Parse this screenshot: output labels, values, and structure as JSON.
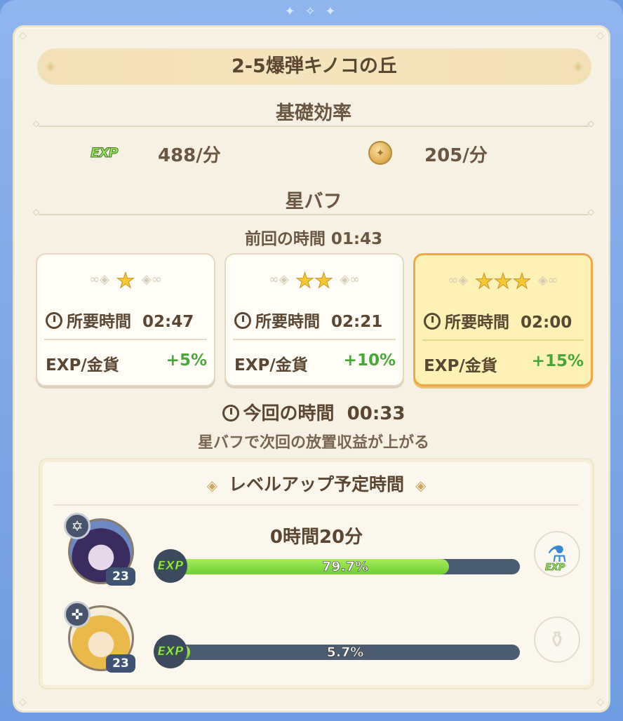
{
  "stage_title": "2-5爆弾キノコの丘",
  "base_efficiency": {
    "heading": "基礎効率",
    "exp_label": "EXP",
    "exp_rate": "488/分",
    "coin_rate": "205/分"
  },
  "star_buff": {
    "heading": "星バフ",
    "previous_time_label": "前回の時間",
    "previous_time": "01:43",
    "cards": [
      {
        "stars": "★",
        "time_label": "所要時間",
        "time": "02:47",
        "bonus_label": "EXP/金貨",
        "bonus": "+5%",
        "selected": false
      },
      {
        "stars": "★★",
        "time_label": "所要時間",
        "time": "02:21",
        "bonus_label": "EXP/金貨",
        "bonus": "+10%",
        "selected": false
      },
      {
        "stars": "★★★",
        "time_label": "所要時間",
        "time": "02:00",
        "bonus_label": "EXP/金貨",
        "bonus": "+15%",
        "selected": true
      }
    ],
    "current_time_label": "今回の時間",
    "current_time": "00:33",
    "hint": "星バフで次回の放置収益が上がる"
  },
  "level_up": {
    "heading": "レベルアップ予定時間",
    "characters": [
      {
        "level": "23",
        "time_to_level": "0時間20分",
        "exp_label": "EXP",
        "progress_text": "79.7%",
        "progress": 0.797,
        "item_label": "EXP",
        "item_icon": "exp-potion-icon",
        "class_icon": "star-of-david-icon"
      },
      {
        "level": "23",
        "time_to_level": "",
        "exp_label": "EXP",
        "progress_text": "5.7%",
        "progress": 0.057,
        "item_icon": "empty-potion-icon",
        "class_icon": "cross-icon"
      }
    ]
  },
  "colors": {
    "accent_selected": "#f2a64a",
    "bonus_green": "#4aa63a",
    "exp_green": "#7fd93b",
    "frame_blue": "#6f9be0"
  }
}
